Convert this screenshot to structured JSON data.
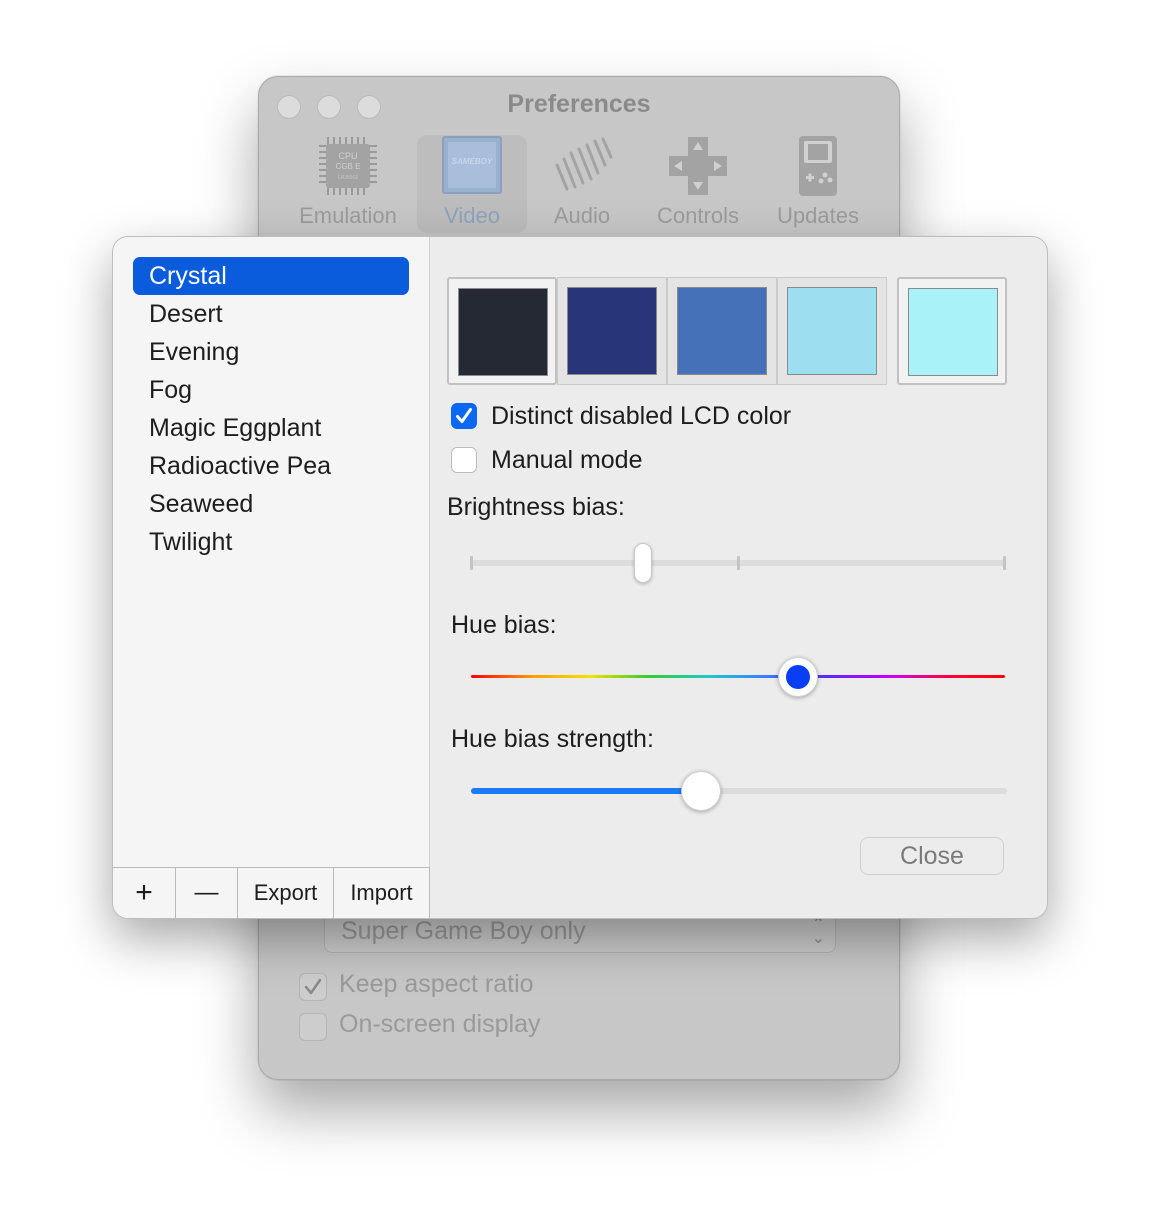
{
  "background_window": {
    "title": "Preferences",
    "toolbar": [
      {
        "label": "Emulation",
        "icon": "cpu-chip-icon",
        "chip_text": [
          "CPU",
          "CGB E",
          "LR35902"
        ],
        "active": false
      },
      {
        "label": "Video",
        "icon": "display-icon",
        "screen_text": "SAMEBOY",
        "active": true
      },
      {
        "label": "Audio",
        "icon": "speaker-grille-icon",
        "active": false
      },
      {
        "label": "Controls",
        "icon": "dpad-icon",
        "active": false
      },
      {
        "label": "Updates",
        "icon": "gameboy-icon",
        "active": false
      }
    ],
    "popup_value": "Super Game Boy only",
    "checkboxes": [
      {
        "label": "Keep aspect ratio",
        "checked": true
      },
      {
        "label": "On-screen display",
        "checked": false
      }
    ]
  },
  "sheet": {
    "palettes": [
      "Crystal",
      "Desert",
      "Evening",
      "Fog",
      "Magic Eggplant",
      "Radioactive Pea",
      "Seaweed",
      "Twilight"
    ],
    "selected_palette": "Crystal",
    "list_toolbar": {
      "add_label": "+",
      "remove_label": "—",
      "export_label": "Export",
      "import_label": "Import"
    },
    "swatch_colors": [
      "#252934",
      "#283578",
      "#4571b8",
      "#9ddff0",
      "#a9f2f8"
    ],
    "distinct_disabled": {
      "label": "Distinct disabled LCD color",
      "checked": true
    },
    "manual_mode": {
      "label": "Manual mode",
      "checked": false
    },
    "brightness": {
      "label": "Brightness bias:",
      "value": 0.32
    },
    "hue": {
      "label": "Hue bias:",
      "value": 0.61
    },
    "hue_strength": {
      "label": "Hue bias strength:",
      "value": 0.43
    },
    "close_label": "Close"
  },
  "colors": {
    "selection": "#0a5cdc",
    "checkbox_on": "#0a68f5",
    "slider_fill": "#1a7bf5",
    "hue_knob": "#0a3ef5"
  }
}
